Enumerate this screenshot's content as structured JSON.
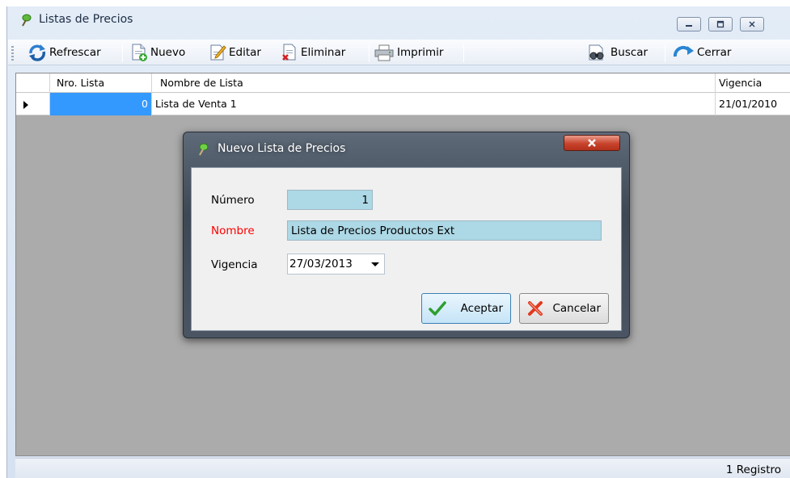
{
  "window": {
    "title": "Listas de Precios",
    "icon": "leaf-pin-icon"
  },
  "toolbar": {
    "refresh_label": "Refrescar",
    "new_label": "Nuevo",
    "edit_label": "Editar",
    "delete_label": "Eliminar",
    "print_label": "Imprimir",
    "search_label": "Buscar",
    "close_label": "Cerrar"
  },
  "grid": {
    "columns": [
      "Nro. Lista",
      "Nombre de Lista",
      "Vigencia"
    ],
    "rows": [
      {
        "number": "0",
        "name": "Lista de Venta 1",
        "validity": "21/01/2010"
      }
    ],
    "selected_color": "#3399ff"
  },
  "status": {
    "text": "1 Registro"
  },
  "dialog": {
    "title": "Nuevo Lista de Precios",
    "number_label": "Número",
    "number_value": "1",
    "name_label": "Nombre",
    "name_value": "Lista de Precios Productos Ext",
    "validity_label": "Vigencia",
    "validity_value": "27/03/2013",
    "accept_label": "Aceptar",
    "cancel_label": "Cancelar",
    "field_color": "#add8e6",
    "required_color": "#ff0000"
  }
}
